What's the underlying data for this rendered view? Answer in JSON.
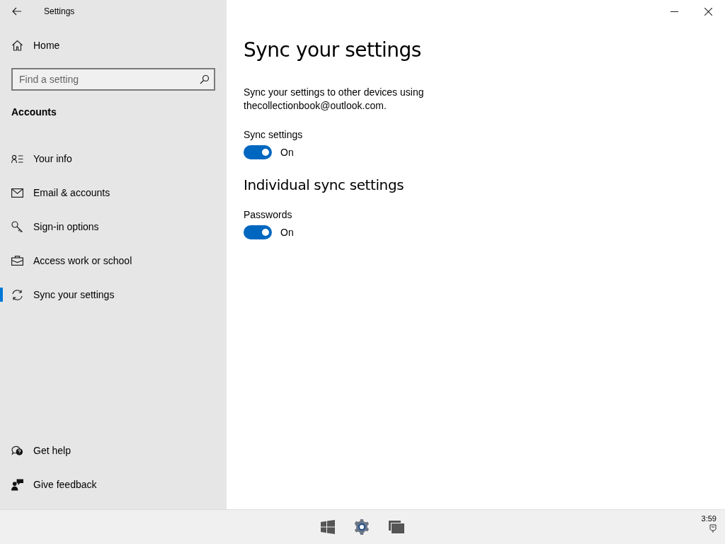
{
  "window": {
    "title": "Settings"
  },
  "sidebar": {
    "home": "Home",
    "search": {
      "placeholder": "Find a setting"
    },
    "section": "Accounts",
    "items": [
      {
        "label": "Your info",
        "selected": false
      },
      {
        "label": "Email & accounts",
        "selected": false
      },
      {
        "label": "Sign-in options",
        "selected": false
      },
      {
        "label": "Access work or school",
        "selected": false
      },
      {
        "label": "Sync your settings",
        "selected": true
      }
    ],
    "footer_items": [
      "Get help",
      "Give feedback"
    ]
  },
  "page": {
    "title": "Sync your settings",
    "description": "Sync your settings to other devices using thecollectionbook@outlook.com.",
    "settings": [
      {
        "label": "Sync settings",
        "on": true,
        "state": "On"
      }
    ],
    "subheading": "Individual sync settings",
    "individual": [
      {
        "label": "Passwords",
        "on": true,
        "state": "On"
      }
    ]
  },
  "taskbar": {
    "clock": "3:59"
  }
}
